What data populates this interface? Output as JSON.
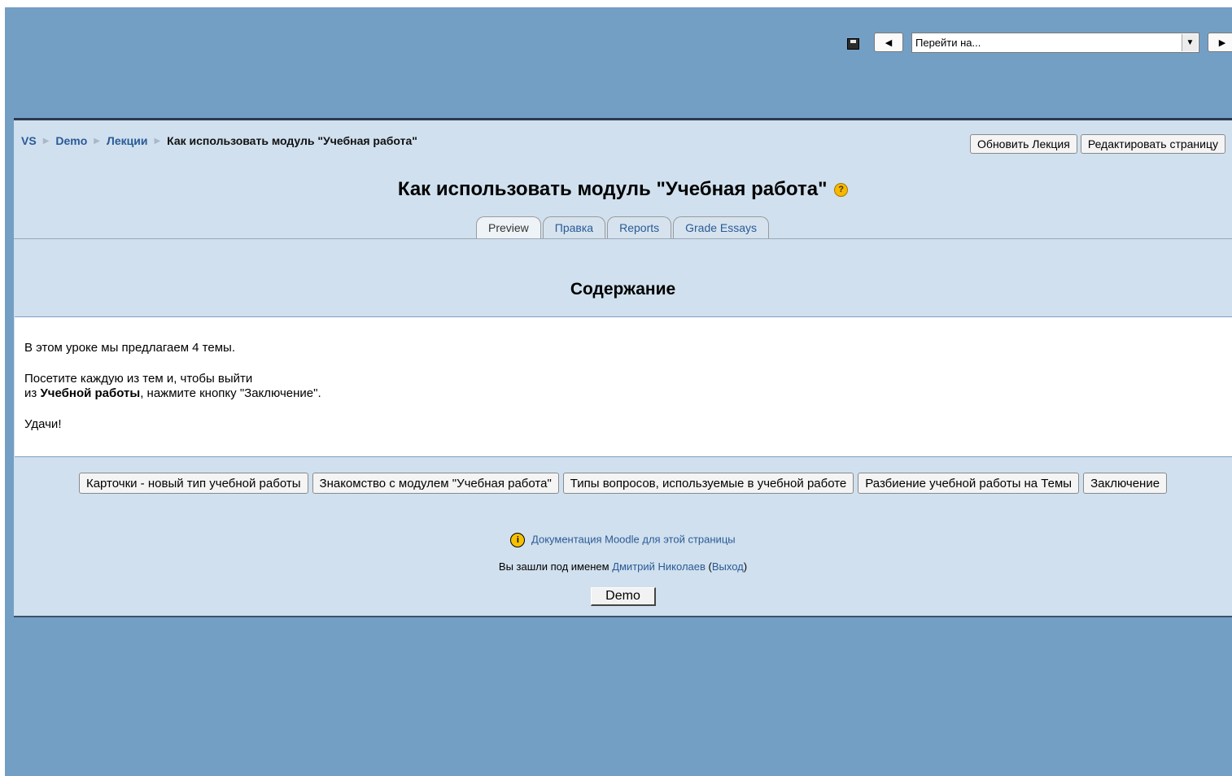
{
  "jump": {
    "save_icon": "save-icon",
    "prev_label": "◀",
    "select_value": "Перейти на...",
    "next_label": "▶"
  },
  "breadcrumb": [
    {
      "label": "VS"
    },
    {
      "label": "Demo"
    },
    {
      "label": "Лекции"
    },
    {
      "label": "Как использовать модуль \"Учебная работа\""
    }
  ],
  "top_buttons": {
    "update": "Обновить Лекция",
    "edit_page": "Редактировать страницу"
  },
  "page_title": "Как использовать модуль \"Учебная работа\"",
  "help_icon": "?",
  "tabs": [
    {
      "label": "Preview",
      "active": true
    },
    {
      "label": "Правка"
    },
    {
      "label": "Reports"
    },
    {
      "label": "Grade Essays"
    }
  ],
  "section_title": "Содержание",
  "content": {
    "line1": "В этом уроке мы предлагаем 4 темы.",
    "line2a": "Посетите каждую из тем и, чтобы выйти",
    "line2b_pre": "из ",
    "line2b_bold": "Учебной работы",
    "line2b_post": ", нажмите кнопку \"Заключение\".",
    "line3": "Удачи!"
  },
  "branch_buttons": [
    "Карточки - новый тип учебной работы",
    "Знакомство с модулем \"Учебная работа\"",
    "Типы вопросов, используемые в учебной работе",
    "Разбиение учебной работы на Темы",
    "Заключение"
  ],
  "footer": {
    "docs_link": "Документация Moodle для этой страницы",
    "login_prefix": "Вы зашли под именем ",
    "user_name": "Дмитрий Николаев",
    "logout_open": " (",
    "logout": "Выход",
    "logout_close": ")",
    "home_button": "Demo"
  }
}
